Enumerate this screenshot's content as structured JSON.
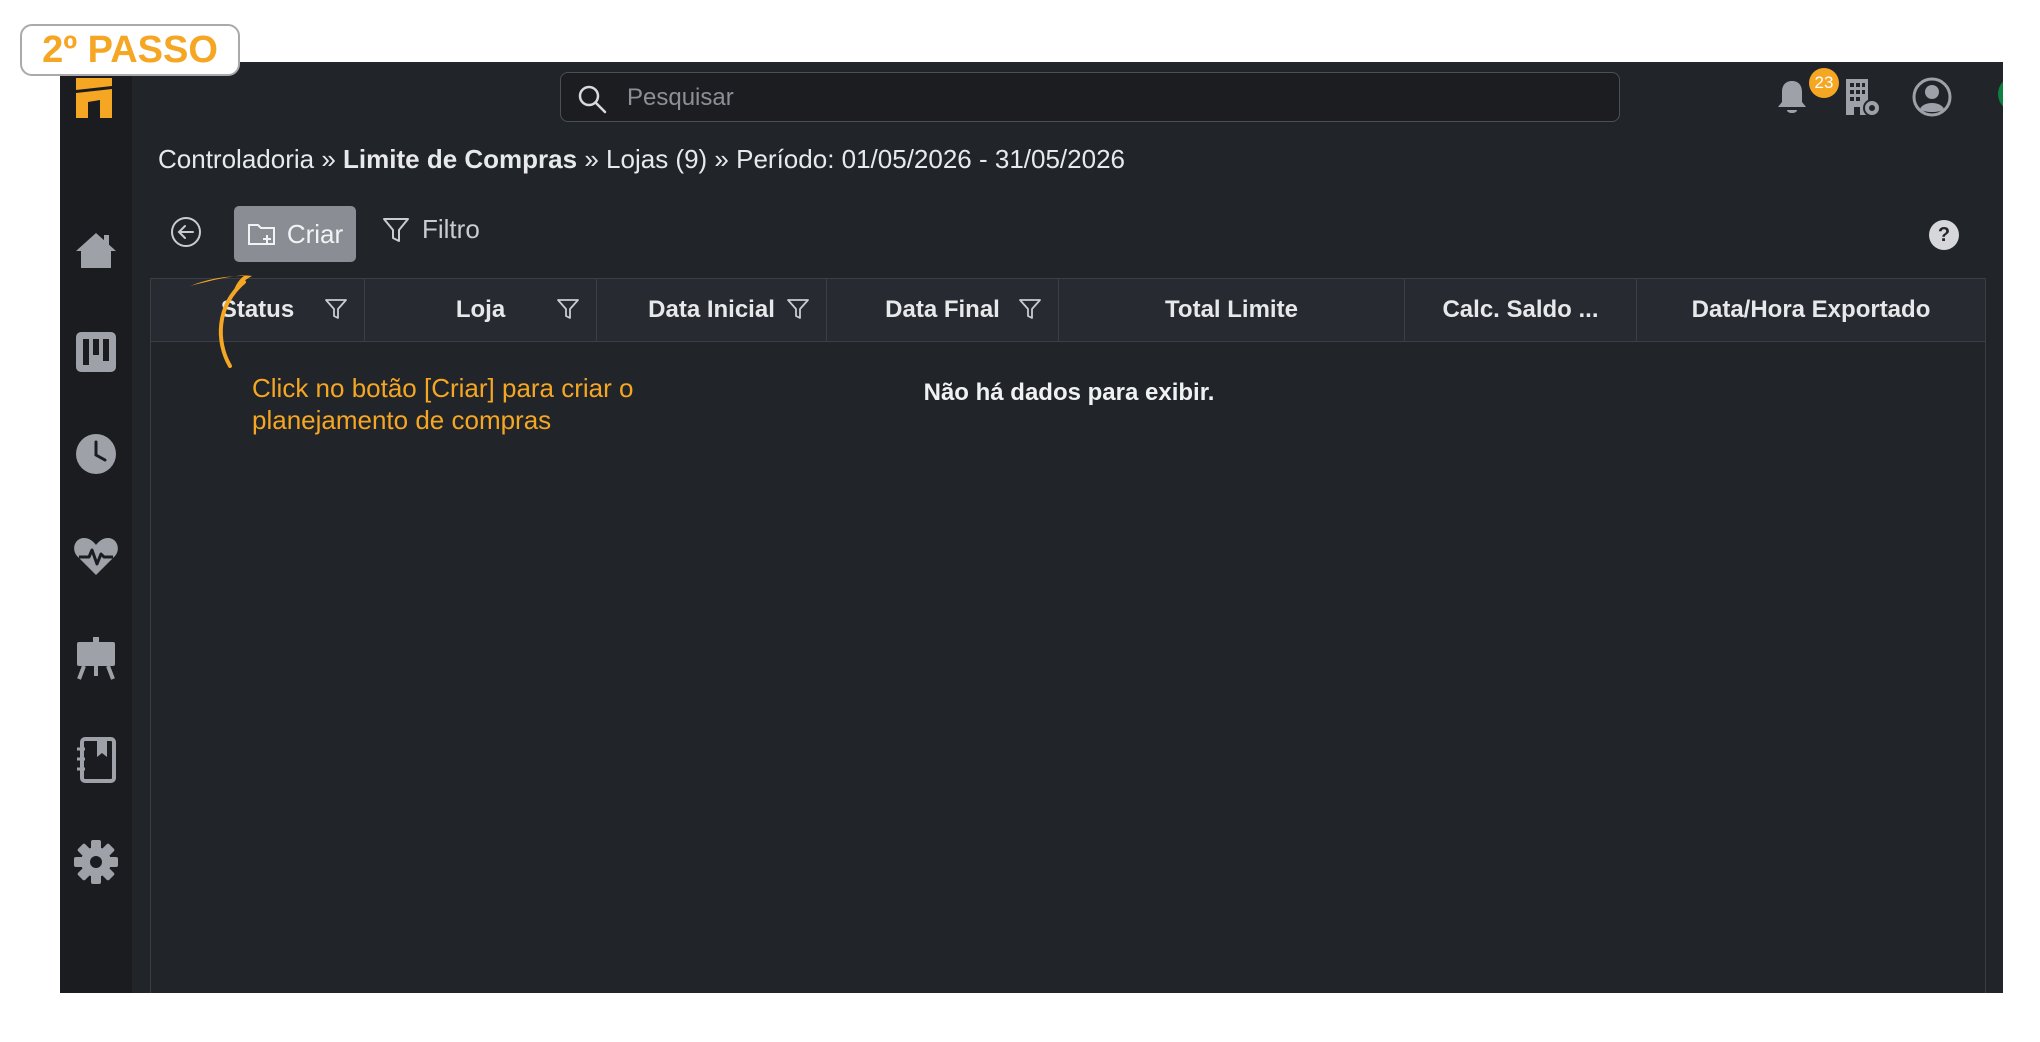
{
  "step_label": "2º PASSO",
  "annotation": {
    "line1": "Click no botão [Criar] para criar o",
    "line2": "planejamento de compras"
  },
  "search": {
    "placeholder": "Pesquisar"
  },
  "notifications": {
    "count": "23"
  },
  "breadcrumb": {
    "part1": "Controladoria",
    "sep": "»",
    "part2": "Limite de Compras",
    "part3": "Lojas (9)",
    "part4": "Período: 01/05/2026 - 31/05/2026"
  },
  "toolbar": {
    "criar_label": "Criar",
    "filtro_label": "Filtro"
  },
  "help_label": "?",
  "grid": {
    "columns": [
      {
        "label": "Status",
        "filter": true
      },
      {
        "label": "Loja",
        "filter": true
      },
      {
        "label": "Data Inicial",
        "filter": true
      },
      {
        "label": "Data Final",
        "filter": true
      },
      {
        "label": "Total Limite",
        "filter": false
      },
      {
        "label": "Calc. Saldo ...",
        "filter": false
      },
      {
        "label": "Data/Hora Exportado",
        "filter": false
      }
    ],
    "empty_message": "Não há dados para exibir."
  },
  "colors": {
    "accent": "#f5a623",
    "background": "#212429",
    "status": "#0e8040"
  },
  "sidebar": {
    "items": [
      {
        "icon": "home-icon"
      },
      {
        "icon": "kanban-icon"
      },
      {
        "icon": "clock-icon"
      },
      {
        "icon": "heartbeat-icon"
      },
      {
        "icon": "presentation-icon"
      },
      {
        "icon": "notebook-icon"
      },
      {
        "icon": "gear-icon"
      }
    ]
  }
}
